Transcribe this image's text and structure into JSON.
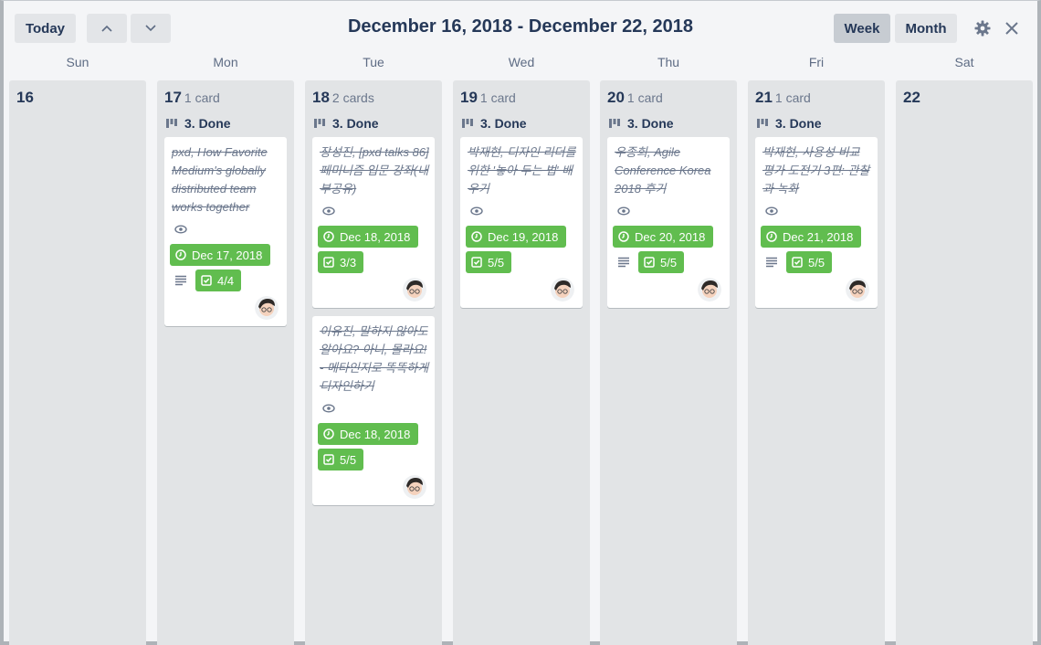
{
  "header": {
    "today_label": "Today",
    "range_title": "December 16, 2018 - December 22, 2018",
    "week_label": "Week",
    "month_label": "Month"
  },
  "day_names": [
    "Sun",
    "Mon",
    "Tue",
    "Wed",
    "Thu",
    "Fri",
    "Sat"
  ],
  "days": [
    {
      "num": "16",
      "count": ""
    },
    {
      "num": "17",
      "count": "1 card"
    },
    {
      "num": "18",
      "count": "2 cards"
    },
    {
      "num": "19",
      "count": "1 card"
    },
    {
      "num": "20",
      "count": "1 card"
    },
    {
      "num": "21",
      "count": "1 card"
    },
    {
      "num": "22",
      "count": ""
    }
  ],
  "list_name": "3. Done",
  "cards": {
    "mon": {
      "title": "pxd, How Favorite Medium's globally distributed team works together",
      "due": "Dec 17, 2018",
      "checklist": "4/4"
    },
    "tue1": {
      "title": "장성진, [pxd talks 86] 페미니즘 입문 강좌(내부공유)",
      "due": "Dec 18, 2018",
      "checklist": "3/3"
    },
    "tue2": {
      "title": "이유진, 말하지 않아도 알아요? 아니, 몰라요! - 메타인지로 똑똑하게 디자인하기",
      "due": "Dec 18, 2018",
      "checklist": "5/5"
    },
    "wed": {
      "title": "박재현, 디자인 리더를 위한 '놓아 두는 법' 배우기",
      "due": "Dec 19, 2018",
      "checklist": "5/5"
    },
    "thu": {
      "title": "우종희, Agile Conference Korea 2018 후기",
      "due": "Dec 20, 2018",
      "checklist": "5/5"
    },
    "fri": {
      "title": "박재현, 사용성 비교 평가 도전기 3편: 관찰과 녹화",
      "due": "Dec 21, 2018",
      "checklist": "5/5"
    }
  },
  "colors": {
    "green_label": "#61bd4f",
    "column_bg": "#e2e4e6",
    "active_button": "#c7ccd2"
  },
  "icons": [
    "chevron-up-icon",
    "chevron-down-icon",
    "gear-icon",
    "close-icon",
    "list-icon",
    "eye-icon",
    "clock-icon",
    "checkbox-icon",
    "description-icon",
    "avatar"
  ]
}
